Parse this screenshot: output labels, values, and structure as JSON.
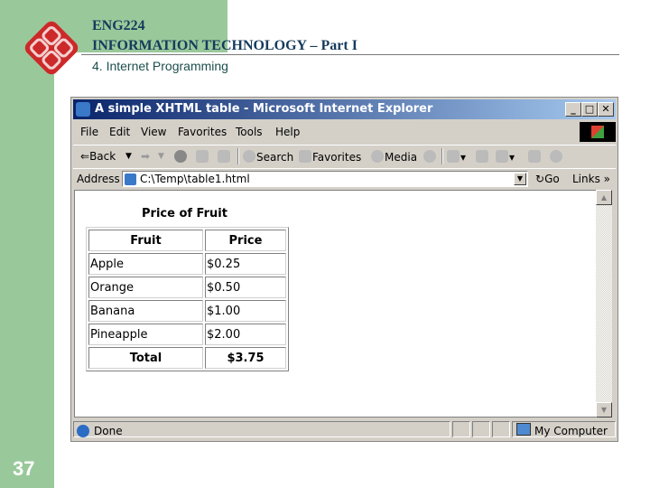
{
  "slide": {
    "course_code": "ENG224",
    "course_title": "INFORMATION TECHNOLOGY – Part I",
    "section": "4. Internet Programming",
    "page_number": "37",
    "colors": {
      "sidebar_green": "#99c99a",
      "title_navy": "#163a5c",
      "logo_red": "#cc2a2a"
    }
  },
  "browser": {
    "title": "A simple XHTML table - Microsoft Internet Explorer",
    "window_buttons": {
      "minimize": "_",
      "maximize": "□",
      "close": "✕"
    },
    "menu": [
      "File",
      "Edit",
      "View",
      "Favorites",
      "Tools",
      "Help"
    ],
    "toolbar": {
      "back": "Back",
      "back_dropdown": "▼",
      "forward": "➡",
      "forward_dropdown": "▼",
      "stop_icon": "stop-icon",
      "refresh_icon": "refresh-icon",
      "home_icon": "home-icon",
      "search": "Search",
      "favorites": "Favorites",
      "media": "Media",
      "history_icon": "history-icon",
      "mail_icon": "mail-icon",
      "print_icon": "print-icon",
      "edit_icon": "edit-icon",
      "discuss_icon": "discuss-icon",
      "messenger_icon": "messenger-icon"
    },
    "address": {
      "label": "Address",
      "value": "C:\\Temp\\table1.html",
      "go": "Go",
      "links": "Links »"
    },
    "page": {
      "caption": "Price of Fruit",
      "headers": [
        "Fruit",
        "Price"
      ],
      "rows": [
        [
          "Apple",
          "$0.25"
        ],
        [
          "Orange",
          "$0.50"
        ],
        [
          "Banana",
          "$1.00"
        ],
        [
          "Pineapple",
          "$2.00"
        ]
      ],
      "footer": [
        "Total",
        "$3.75"
      ]
    },
    "status": {
      "text": "Done",
      "zone": "My Computer"
    }
  }
}
